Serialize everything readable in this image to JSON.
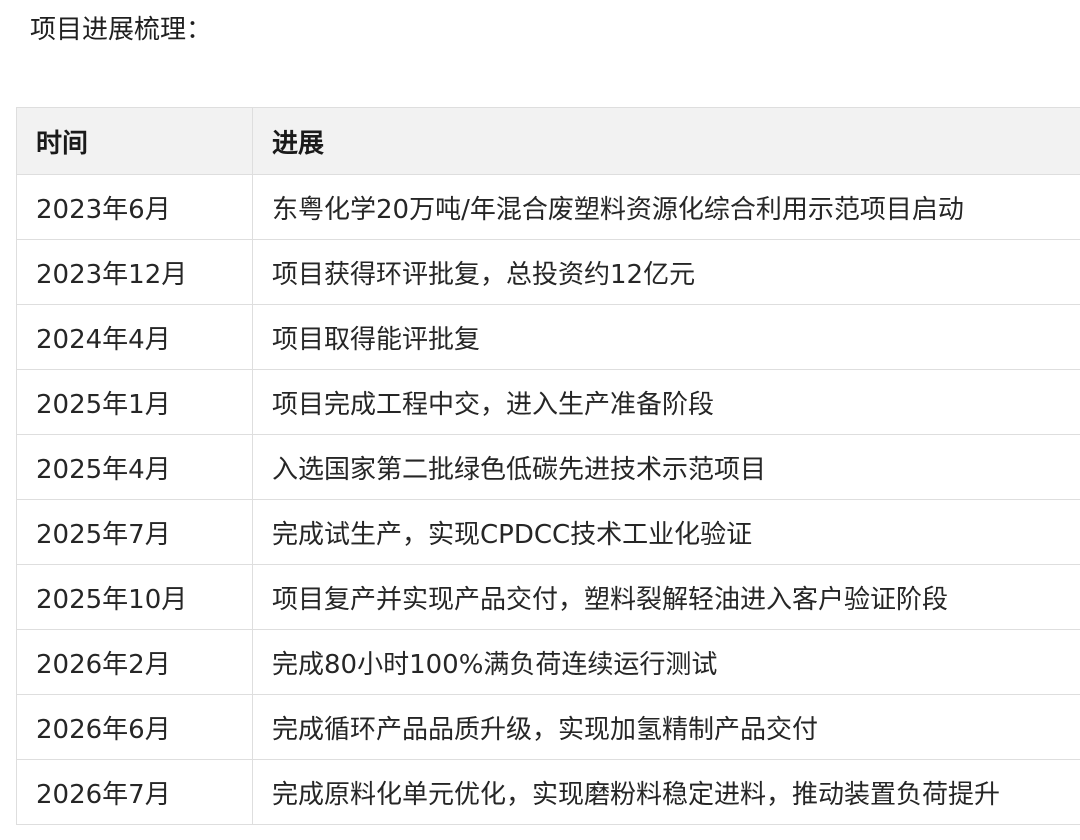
{
  "heading": "项目进展梳理：",
  "table": {
    "columns": [
      "时间",
      "进展"
    ],
    "rows": [
      [
        "2023年6月",
        "东粤化学20万吨/年混合废塑料资源化综合利用示范项目启动"
      ],
      [
        "2023年12月",
        "项目获得环评批复，总投资约12亿元"
      ],
      [
        "2024年4月",
        "项目取得能评批复"
      ],
      [
        "2025年1月",
        "项目完成工程中交，进入生产准备阶段"
      ],
      [
        "2025年4月",
        "入选国家第二批绿色低碳先进技术示范项目"
      ],
      [
        "2025年7月",
        "完成试生产，实现CPDCC技术工业化验证"
      ],
      [
        "2025年10月",
        "项目复产并实现产品交付，塑料裂解轻油进入客户验证阶段"
      ],
      [
        "2026年2月",
        "完成80小时100%满负荷连续运行测试"
      ],
      [
        "2026年6月",
        "完成循环产品品质升级，实现加氢精制产品交付"
      ],
      [
        "2026年7月",
        "完成原料化单元优化，实现磨粉料稳定进料，推动装置负荷提升"
      ]
    ]
  }
}
